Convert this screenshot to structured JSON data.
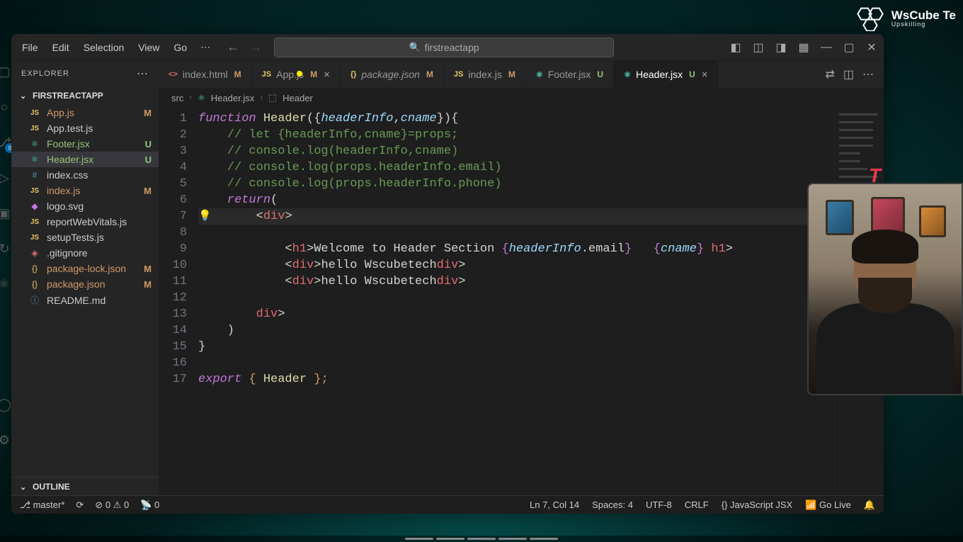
{
  "watermark": {
    "brand": "WsCube Te",
    "tag": "Upskilling"
  },
  "menubar": [
    "File",
    "Edit",
    "Selection",
    "View",
    "Go"
  ],
  "search": {
    "placeholder": "firstreactapp"
  },
  "explorer": {
    "title": "EXPLORER",
    "folder": "FIRSTREACTAPP"
  },
  "files": [
    {
      "icon": "JS",
      "iconcls": "js",
      "name": "App.js",
      "status": "M",
      "cls": "modified"
    },
    {
      "icon": "JS",
      "iconcls": "js",
      "name": "App.test.js",
      "status": "",
      "cls": ""
    },
    {
      "icon": "⚛",
      "iconcls": "react",
      "name": "Footer.jsx",
      "status": "U",
      "cls": "untracked"
    },
    {
      "icon": "⚛",
      "iconcls": "react",
      "name": "Header.jsx",
      "status": "U",
      "cls": "untracked sel"
    },
    {
      "icon": "#",
      "iconcls": "css",
      "name": "index.css",
      "status": "",
      "cls": ""
    },
    {
      "icon": "JS",
      "iconcls": "js",
      "name": "index.js",
      "status": "M",
      "cls": "modified"
    },
    {
      "icon": "◆",
      "iconcls": "svg",
      "name": "logo.svg",
      "status": "",
      "cls": ""
    },
    {
      "icon": "JS",
      "iconcls": "js",
      "name": "reportWebVitals.js",
      "status": "",
      "cls": ""
    },
    {
      "icon": "JS",
      "iconcls": "js",
      "name": "setupTests.js",
      "status": "",
      "cls": ""
    },
    {
      "icon": "◈",
      "iconcls": "git",
      "name": ".gitignore",
      "status": "",
      "cls": ""
    },
    {
      "icon": "{}",
      "iconcls": "json",
      "name": "package-lock.json",
      "status": "M",
      "cls": "modified"
    },
    {
      "icon": "{}",
      "iconcls": "json",
      "name": "package.json",
      "status": "M",
      "cls": "modified"
    },
    {
      "icon": "ⓘ",
      "iconcls": "md",
      "name": "README.md",
      "status": "",
      "cls": ""
    }
  ],
  "outline": {
    "title": "OUTLINE",
    "item": "Header"
  },
  "tabs": [
    {
      "icon": "<>",
      "iconcls": "html",
      "name": "index.html",
      "status": "M",
      "italic": false,
      "close": false,
      "active": false
    },
    {
      "icon": "JS",
      "iconcls": "js",
      "name": "App.js",
      "status": "M",
      "italic": false,
      "close": true,
      "active": false
    },
    {
      "icon": "{}",
      "iconcls": "json",
      "name": "package.json",
      "status": "M",
      "italic": true,
      "close": false,
      "active": false
    },
    {
      "icon": "JS",
      "iconcls": "js",
      "name": "index.js",
      "status": "M",
      "italic": false,
      "close": false,
      "active": false
    },
    {
      "icon": "⚛",
      "iconcls": "react",
      "name": "Footer.jsx",
      "status": "U",
      "italic": false,
      "close": false,
      "active": false
    },
    {
      "icon": "⚛",
      "iconcls": "react",
      "name": "Header.jsx",
      "status": "U",
      "italic": false,
      "close": true,
      "active": true
    }
  ],
  "breadcrumb": {
    "p1": "src",
    "p2": "Header.jsx",
    "p3": "Header"
  },
  "code": {
    "lines": [
      "1",
      "2",
      "3",
      "4",
      "5",
      "6",
      "7",
      "8",
      "9",
      "10",
      "11",
      "12",
      "13",
      "14",
      "15",
      "16",
      "17"
    ],
    "l1": {
      "kw": "function",
      "fn": " Header",
      "p1": "({",
      "v1": "headerInfo",
      "c1": ",",
      "v2": "cname",
      "p2": "}){"
    },
    "l2": "    // let {headerInfo,cname}=props;",
    "l3": "    // console.log(headerInfo,cname)",
    "l4": "    // console.log(props.headerInfo.email)",
    "l5": "    // console.log(props.headerInfo.phone)",
    "l6": {
      "kw": "return",
      "p": "("
    },
    "l7": {
      "a": "        <",
      "t": "div",
      "b": ">"
    },
    "l9": {
      "pre": "            <",
      "t1": "h1",
      "gt": ">",
      "txt1": "Welcome to Header Section ",
      "ob": "{",
      "v1": "headerInfo",
      "dot": ".email",
      "cb": "}",
      "sp": "   ",
      "ob2": "{",
      "v2": "cname",
      "cb2": "}",
      "sp2": " ",
      "lt": "</",
      "t2": "h1",
      "gt2": ">"
    },
    "l10": {
      "pre": "            <",
      "t": "div",
      "gt": ">",
      "txt": "hello Wscubetech",
      "lt": "</",
      "t2": "div",
      "gt2": ">"
    },
    "l11": {
      "pre": "            <",
      "t": "div",
      "gt": ">",
      "txt": "hello Wscubetech",
      "lt": "</",
      "t2": "div",
      "gt2": ">"
    },
    "l13": {
      "pre": "        </",
      "t": "div",
      "gt": ">"
    },
    "l14": "    )",
    "l15": "}",
    "l17": {
      "kw": "export",
      "sp": " ",
      "ob": "{",
      "fn": " Header ",
      "cb": "};"
    }
  },
  "status": {
    "branch": "master*",
    "err": "0",
    "warn": "0",
    "port": "0",
    "pos": "Ln 7, Col 14",
    "spaces": "Spaces: 4",
    "enc": "UTF-8",
    "eol": "CRLF",
    "lang": "JavaScript JSX",
    "live": "Go Live"
  },
  "scm_badge": "8",
  "bigT": "T"
}
